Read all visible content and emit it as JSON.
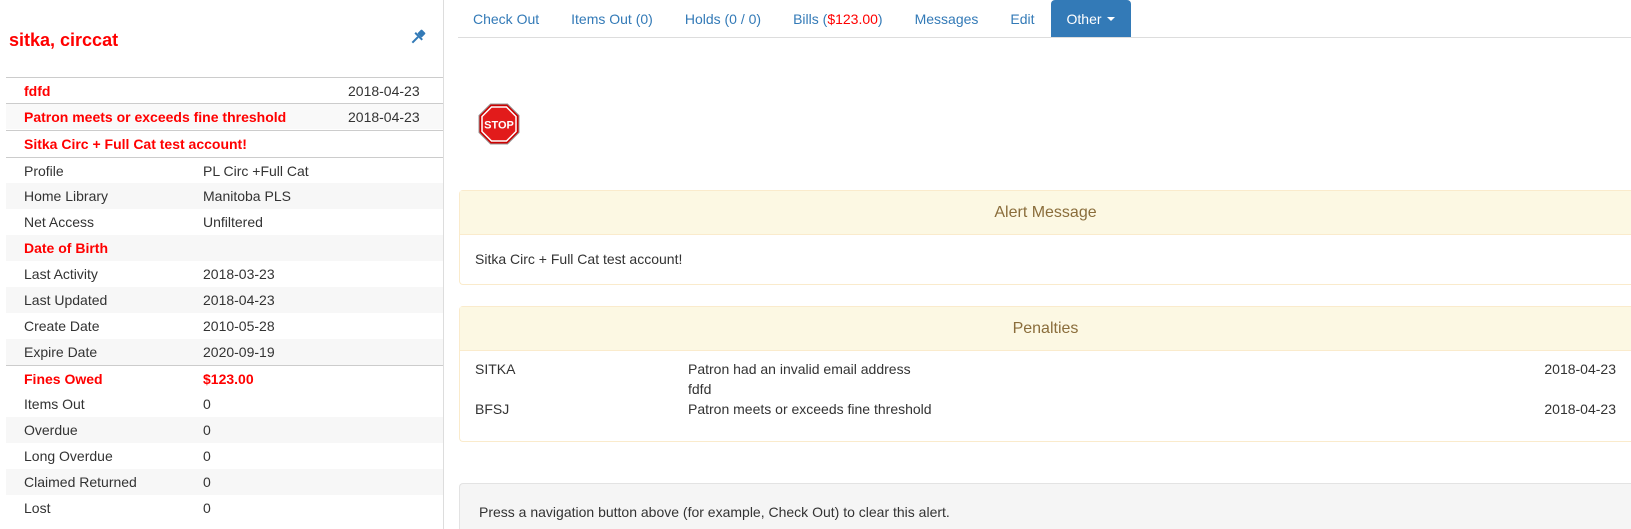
{
  "patron": {
    "name": "sitka, circcat",
    "messages": [
      {
        "label": "fdfd",
        "date": "2018-04-23"
      },
      {
        "label": "Patron meets or exceeds fine threshold",
        "date": "2018-04-23"
      }
    ],
    "alert": "Sitka Circ + Full Cat test account!",
    "info": [
      {
        "label": "Profile",
        "value": "PL Circ +Full Cat"
      },
      {
        "label": "Home Library",
        "value": "Manitoba PLS"
      },
      {
        "label": "Net Access",
        "value": "Unfiltered"
      },
      {
        "label": "Date of Birth",
        "value": ""
      },
      {
        "label": "Last Activity",
        "value": "2018-03-23"
      },
      {
        "label": "Last Updated",
        "value": "2018-04-23"
      },
      {
        "label": "Create Date",
        "value": "2010-05-28"
      },
      {
        "label": "Expire Date",
        "value": "2020-09-19"
      },
      {
        "label": "Fines Owed",
        "value": "$123.00"
      },
      {
        "label": "Items Out",
        "value": "0"
      },
      {
        "label": "Overdue",
        "value": "0"
      },
      {
        "label": "Long Overdue",
        "value": "0"
      },
      {
        "label": "Claimed Returned",
        "value": "0"
      },
      {
        "label": "Lost",
        "value": "0"
      }
    ]
  },
  "nav": {
    "check_out": "Check Out",
    "items_out": "Items Out (0)",
    "holds": "Holds (0 / 0)",
    "bills_prefix": "Bills (",
    "bills_amount": "$123.00",
    "bills_suffix": ")",
    "messages": "Messages",
    "edit": "Edit",
    "other": "Other"
  },
  "icons": {
    "pin": "pin-icon",
    "stop": "stop-sign-icon",
    "stop_text": "STOP"
  },
  "alert_panel": {
    "heading": "Alert Message",
    "body": "Sitka Circ + Full Cat test account!"
  },
  "penalties": {
    "heading": "Penalties",
    "rows": [
      {
        "org": "SITKA",
        "description": "Patron had an invalid email address",
        "note": "fdfd",
        "date": "2018-04-23"
      },
      {
        "org": "BFSJ",
        "description": "Patron meets or exceeds fine threshold",
        "note": "",
        "date": "2018-04-23"
      }
    ]
  },
  "notice": "Press a navigation button above (for example, Check Out) to clear this alert.",
  "colors": {
    "alert_red": "#ff0000",
    "link_blue": "#337ab7",
    "panel_heading_bg": "#fcf8e3",
    "panel_heading_text": "#8a6d3b"
  }
}
